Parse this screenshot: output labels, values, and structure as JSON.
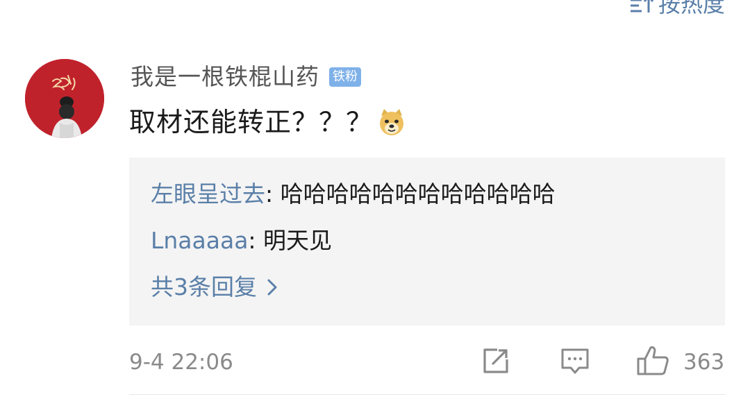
{
  "sort": {
    "label": "按热度",
    "icon": "sort-icon"
  },
  "comment": {
    "avatar_icon": "avatar",
    "username": "我是一根铁棍山药",
    "badge": "铁粉",
    "text": "取材还能转正？？？",
    "emoji": "doge-emoji",
    "timestamp": "9-4 22:06",
    "like_count": "363"
  },
  "replies": {
    "items": [
      {
        "author": "左眼呈过去",
        "text": "哈哈哈哈哈哈哈哈哈哈哈哈"
      },
      {
        "author": "Lnaaaaa",
        "text": "明天见"
      }
    ],
    "more_label": "共3条回复"
  },
  "colors": {
    "link": "#5a7fa8",
    "badge_bg": "#7fb1e9",
    "avatar_bg": "#c0222c",
    "reply_bg": "#f4f4f4",
    "meta_text": "#8a8a8a"
  }
}
